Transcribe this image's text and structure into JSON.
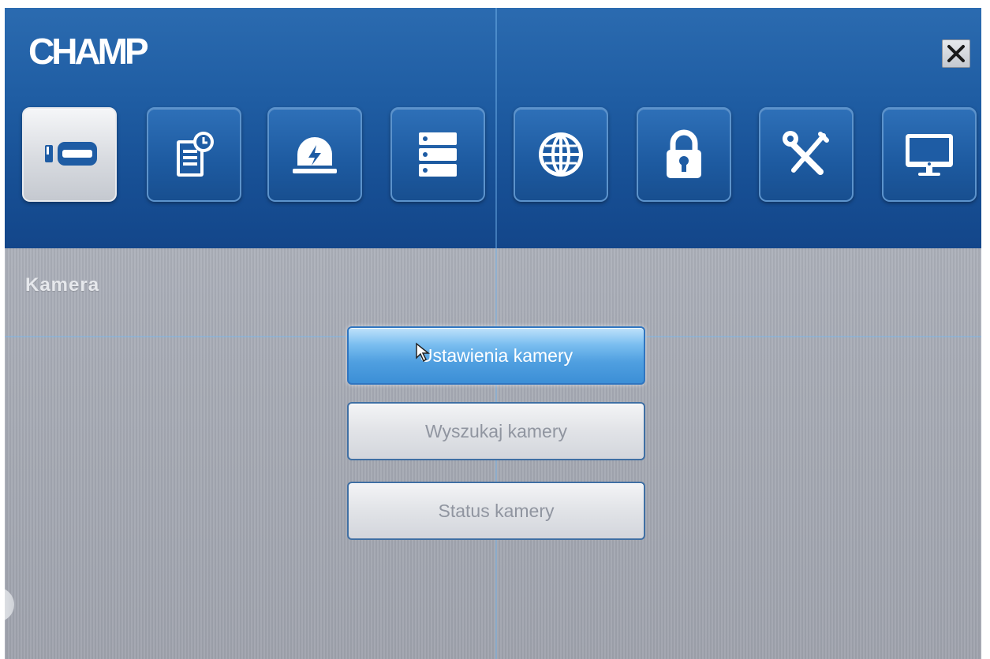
{
  "app": {
    "brand": "CHAMP",
    "close_icon": "close-x-icon"
  },
  "colors": {
    "header_blue": "#1f5da3",
    "content_gray": "#a9adb7",
    "active_button_blue": "#4f9fe0"
  },
  "toolbar": {
    "icons": [
      {
        "name": "camera-icon",
        "active": true
      },
      {
        "name": "schedule-record-icon",
        "active": false
      },
      {
        "name": "alarm-icon",
        "active": false
      },
      {
        "name": "storage-icon",
        "active": false
      },
      {
        "name": "network-icon",
        "active": false
      },
      {
        "name": "lock-icon",
        "active": false
      },
      {
        "name": "tools-icon",
        "active": false
      },
      {
        "name": "monitor-icon",
        "active": false
      }
    ]
  },
  "main": {
    "section_title": "Kamera",
    "buttons": [
      {
        "label": "Ustawienia kamery",
        "active": true
      },
      {
        "label": "Wyszukaj kamery",
        "active": false
      },
      {
        "label": "Status kamery",
        "active": false
      }
    ]
  }
}
